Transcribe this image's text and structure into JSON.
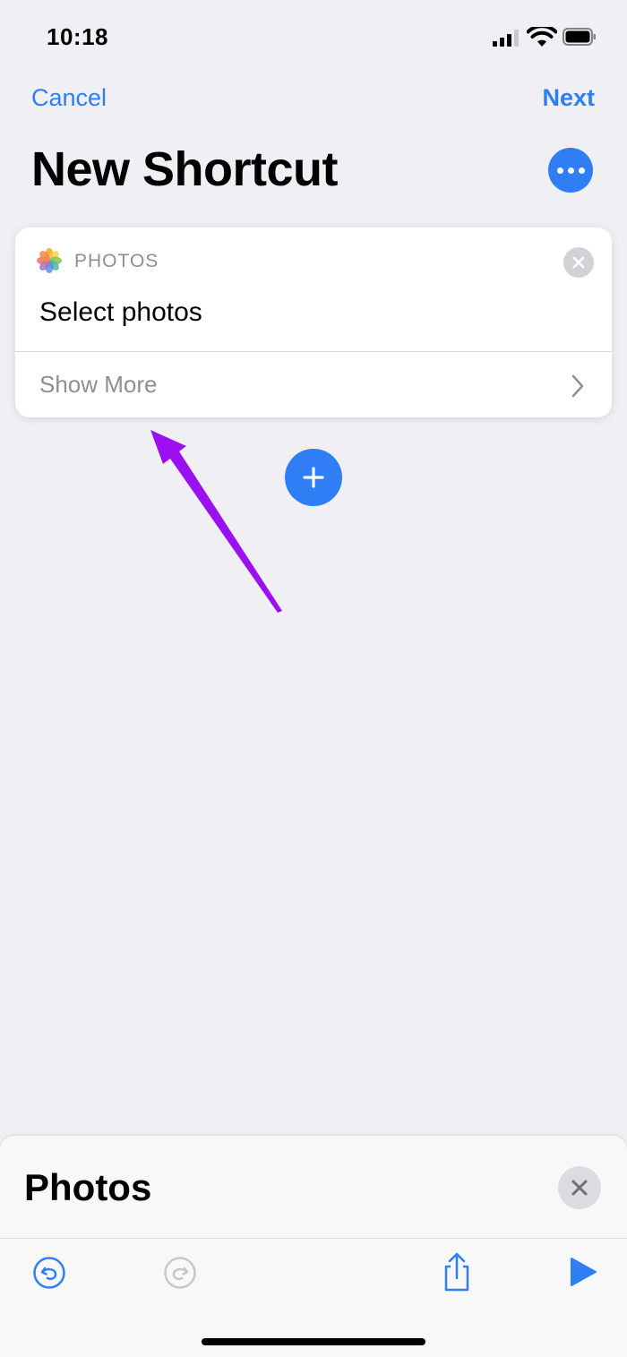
{
  "status_bar": {
    "time": "10:18"
  },
  "nav": {
    "cancel_label": "Cancel",
    "next_label": "Next"
  },
  "page": {
    "title": "New Shortcut"
  },
  "action_card": {
    "app_name": "PHOTOS",
    "title": "Select photos",
    "show_more_label": "Show More"
  },
  "sheet": {
    "title": "Photos"
  },
  "colors": {
    "accent": "#2f7ef6",
    "background": "#efeff4",
    "annotation_arrow": "#9b10f0",
    "secondary_text": "#8e8e93"
  },
  "icons": {
    "more": "ellipsis-icon",
    "add": "plus-icon",
    "close": "close-icon",
    "undo": "undo-icon",
    "redo": "redo-icon",
    "share": "share-icon",
    "run": "play-icon"
  }
}
